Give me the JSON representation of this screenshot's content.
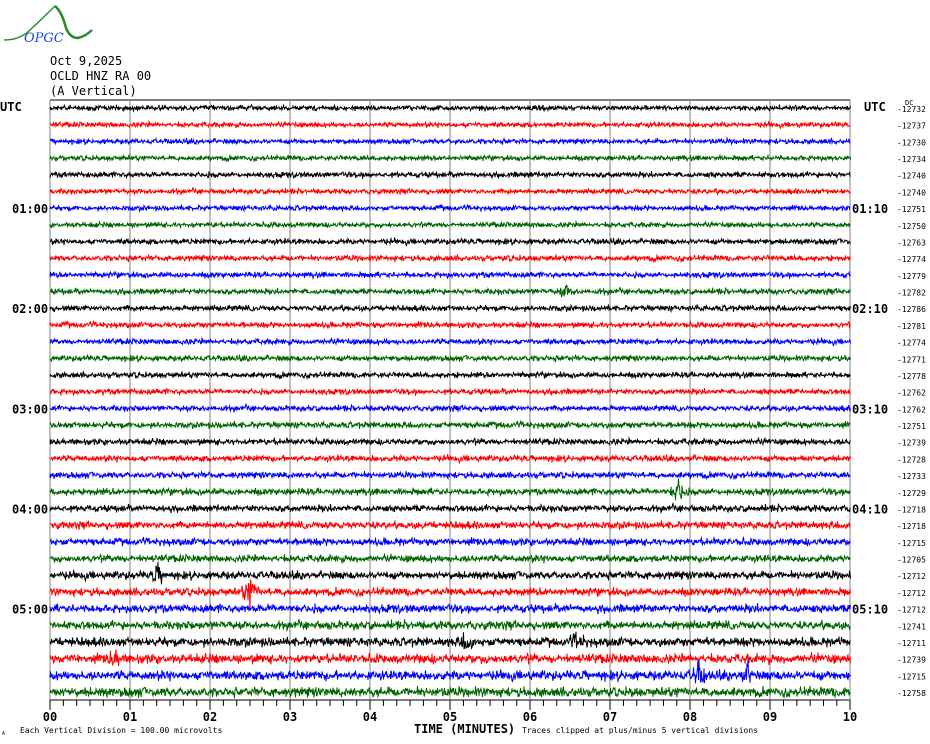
{
  "header": {
    "logo_text": "OPGC",
    "date": "Oct 9,2025",
    "station": "OCLD HNZ RA 00",
    "component": "(A Vertical)"
  },
  "chart_data": {
    "type": "line",
    "title": "OCLD HNZ RA 00 helicorder",
    "xlabel": "TIME (MINUTES)",
    "xlim": [
      0,
      10
    ],
    "x_ticks": [
      "00",
      "01",
      "02",
      "03",
      "04",
      "05",
      "06",
      "07",
      "08",
      "09",
      "10"
    ],
    "minor_tick_interval_minutes": 0.1667,
    "left_axis_title": "UTC",
    "right_axis_title": "UTC",
    "dc_title": "DC",
    "left_hour_labels": [
      {
        "row": 6,
        "label": "01:00"
      },
      {
        "row": 12,
        "label": "02:00"
      },
      {
        "row": 18,
        "label": "03:00"
      },
      {
        "row": 24,
        "label": "04:00"
      },
      {
        "row": 30,
        "label": "05:00"
      }
    ],
    "right_hour_labels": [
      {
        "row": 6,
        "label": "01:10"
      },
      {
        "row": 12,
        "label": "02:10"
      },
      {
        "row": 18,
        "label": "03:10"
      },
      {
        "row": 24,
        "label": "04:10"
      },
      {
        "row": 30,
        "label": "05:10"
      }
    ],
    "trace_colors": [
      "#000000",
      "#ff0000",
      "#0000ff",
      "#006400"
    ],
    "dc_offsets": [
      -12732,
      -12737,
      -12730,
      -12734,
      -12740,
      -12740,
      -12751,
      -12750,
      -12763,
      -12774,
      -12779,
      -12782,
      -12786,
      -12781,
      -12774,
      -12771,
      -12778,
      -12762,
      -12762,
      -12751,
      -12739,
      -12728,
      -12733,
      -12729,
      -12718,
      -12718,
      -12715,
      -12705,
      -12712,
      -12712,
      -12712,
      -12741,
      -12711,
      -12739,
      -12715,
      -12758
    ],
    "trace_noise_amplitude": [
      0.18,
      0.18,
      0.18,
      0.18,
      0.2,
      0.18,
      0.18,
      0.18,
      0.2,
      0.2,
      0.2,
      0.2,
      0.2,
      0.2,
      0.2,
      0.2,
      0.2,
      0.2,
      0.2,
      0.22,
      0.22,
      0.22,
      0.22,
      0.24,
      0.24,
      0.26,
      0.26,
      0.26,
      0.28,
      0.28,
      0.3,
      0.3,
      0.32,
      0.34,
      0.34,
      0.34
    ],
    "events": [
      {
        "trace": 23,
        "minute": 7.85,
        "amplitude": 0.8
      },
      {
        "trace": 29,
        "minute": 2.5,
        "amplitude": 0.9
      },
      {
        "trace": 28,
        "minute": 1.35,
        "amplitude": 0.6
      },
      {
        "trace": 34,
        "minute": 8.1,
        "amplitude": 0.7
      },
      {
        "trace": 34,
        "minute": 8.7,
        "amplitude": 0.7
      },
      {
        "trace": 11,
        "minute": 6.45,
        "amplitude": 0.4
      },
      {
        "trace": 33,
        "minute": 0.8,
        "amplitude": 0.5
      },
      {
        "trace": 32,
        "minute": 5.2,
        "amplitude": 0.45
      },
      {
        "trace": 32,
        "minute": 6.6,
        "amplitude": 0.45
      }
    ]
  },
  "footer": {
    "scale_note": "Each Vertical Division =  100.00 microvolts",
    "clip_note": "Traces clipped at plus/minus 5 vertical divisions",
    "corner_mark": "A"
  }
}
